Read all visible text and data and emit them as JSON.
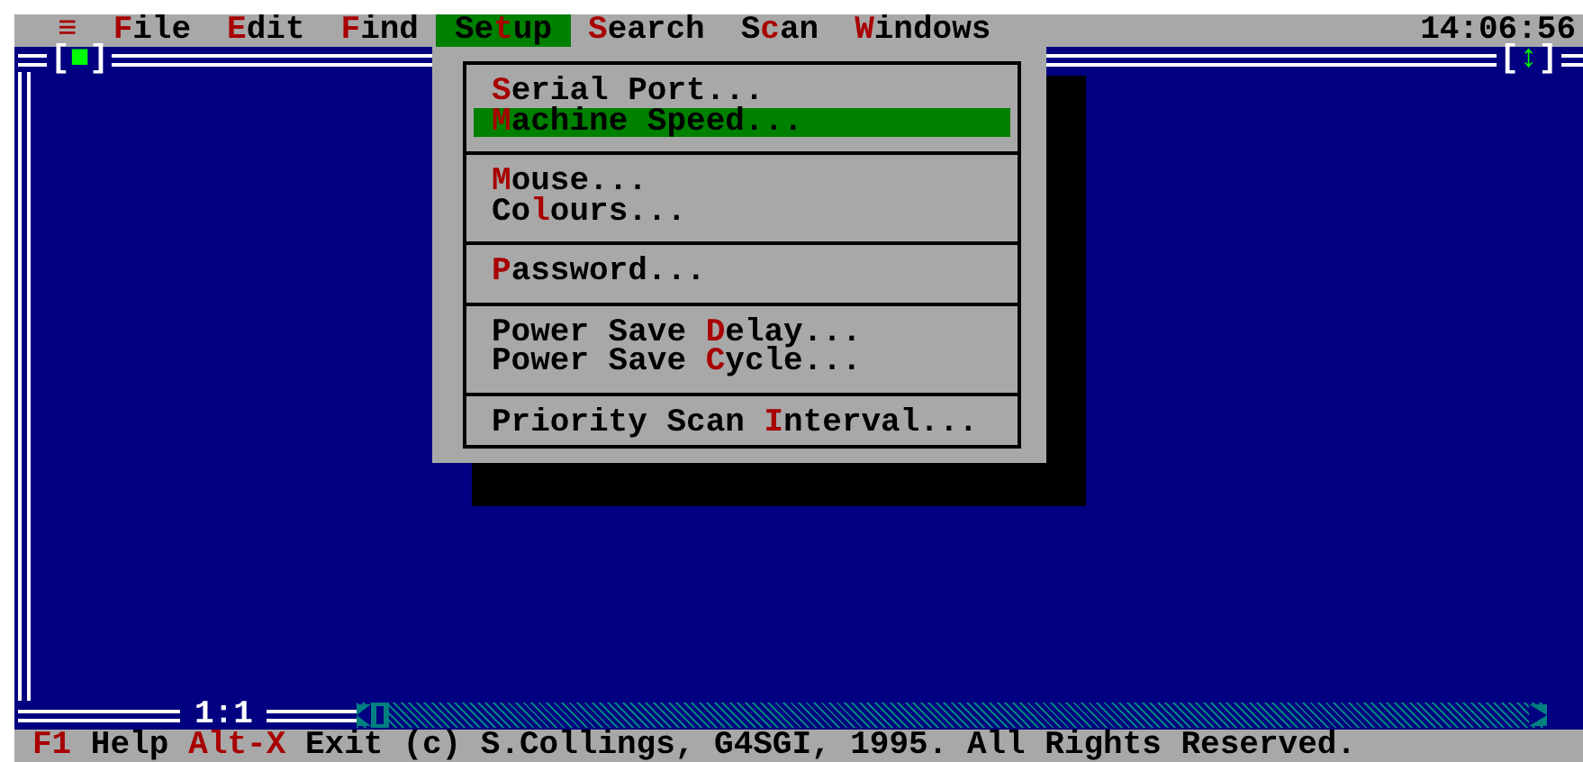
{
  "menu_bar": {
    "items": [
      {
        "key": "≡",
        "selected": false
      },
      {
        "key": "F",
        "post": "ile",
        "selected": false
      },
      {
        "key": "E",
        "post": "dit",
        "selected": false
      },
      {
        "key": "F",
        "post": "ind",
        "selected": false
      },
      {
        "pre": "Se",
        "key": "t",
        "post": "up",
        "selected": true
      },
      {
        "key": "S",
        "post": "earch",
        "selected": false
      },
      {
        "pre": "S",
        "key": "c",
        "post": "an",
        "selected": false
      },
      {
        "key": "W",
        "post": "indows",
        "selected": false
      }
    ],
    "clock": "14:06:56"
  },
  "setup_menu": {
    "groups": [
      [
        {
          "key": "S",
          "post": "erial Port...",
          "selected": false
        },
        {
          "key": "M",
          "post": "achine Speed...",
          "selected": true
        }
      ],
      [
        {
          "key": "M",
          "post": "ouse...",
          "selected": false
        },
        {
          "pre": "Co",
          "key": "l",
          "post": "ours...",
          "selected": false
        }
      ],
      [
        {
          "key": "P",
          "post": "assword...",
          "selected": false
        }
      ],
      [
        {
          "pre": "Power Save ",
          "key": "D",
          "post": "elay...",
          "selected": false
        },
        {
          "pre": "Power Save ",
          "key": "C",
          "post": "ycle...",
          "selected": false
        }
      ],
      [
        {
          "pre": "Priority Scan ",
          "key": "I",
          "post": "nterval...",
          "selected": false
        }
      ]
    ]
  },
  "window": {
    "close_button": "[■]",
    "zoom_button": "[↕]",
    "position": "1:1"
  },
  "status_bar": {
    "items": [
      {
        "key": "F1",
        "label": "Help"
      },
      {
        "key": "Alt-X",
        "label": "Exit"
      }
    ],
    "copyright": "(c) S.Collings, G4SGI, 1995. All Rights Reserved."
  }
}
